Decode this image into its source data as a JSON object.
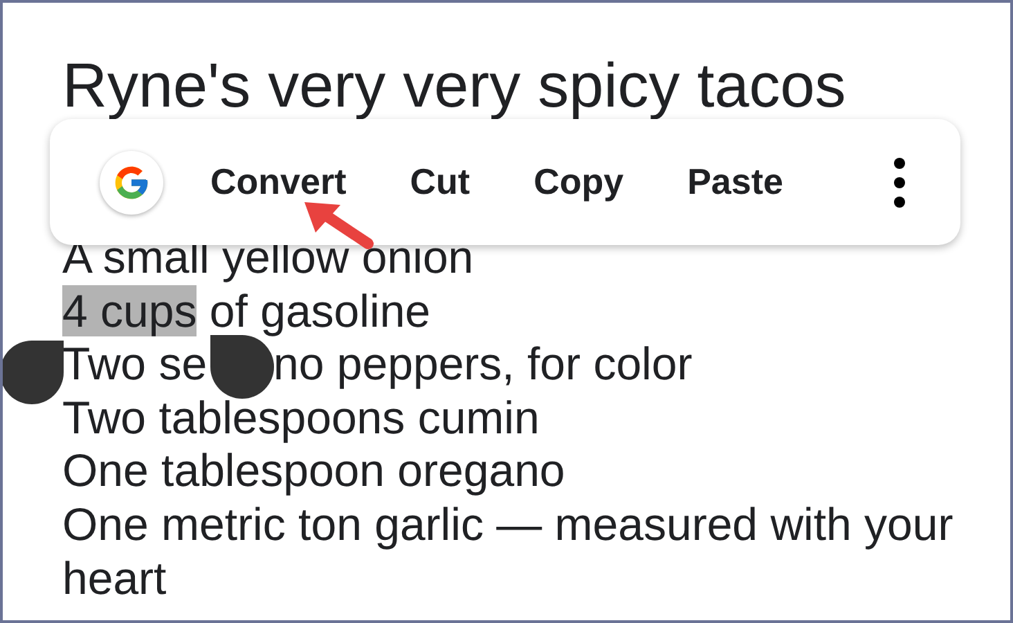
{
  "title": "Ryne's very very spicy tacos",
  "toolbar": [
    {
      "kind": "google"
    },
    {
      "kind": "text",
      "label": "Convert"
    },
    {
      "kind": "text",
      "label": "Cut"
    },
    {
      "kind": "text",
      "label": "Copy"
    },
    {
      "kind": "text",
      "label": "Paste"
    },
    {
      "kind": "more"
    }
  ],
  "lines": [
    {
      "segments": [
        {
          "text": "A small yellow onion",
          "selected": false
        }
      ]
    },
    {
      "segments": [
        {
          "text": "4 cups",
          "selected": true
        },
        {
          "text": " of gasoline",
          "selected": false
        }
      ]
    },
    {
      "segments": [
        {
          "text": "Two se",
          "selected": false
        },
        {
          "kind": "handle"
        },
        {
          "text": "no peppers, for color",
          "selected": false
        }
      ]
    },
    {
      "segments": [
        {
          "text": "Two tablespoons cumin",
          "selected": false
        }
      ]
    },
    {
      "segments": [
        {
          "text": "One tablespoon oregano",
          "selected": false
        }
      ]
    },
    {
      "segments": [
        {
          "text": "One metric ton garlic — measured with your heart",
          "selected": false
        }
      ]
    }
  ]
}
